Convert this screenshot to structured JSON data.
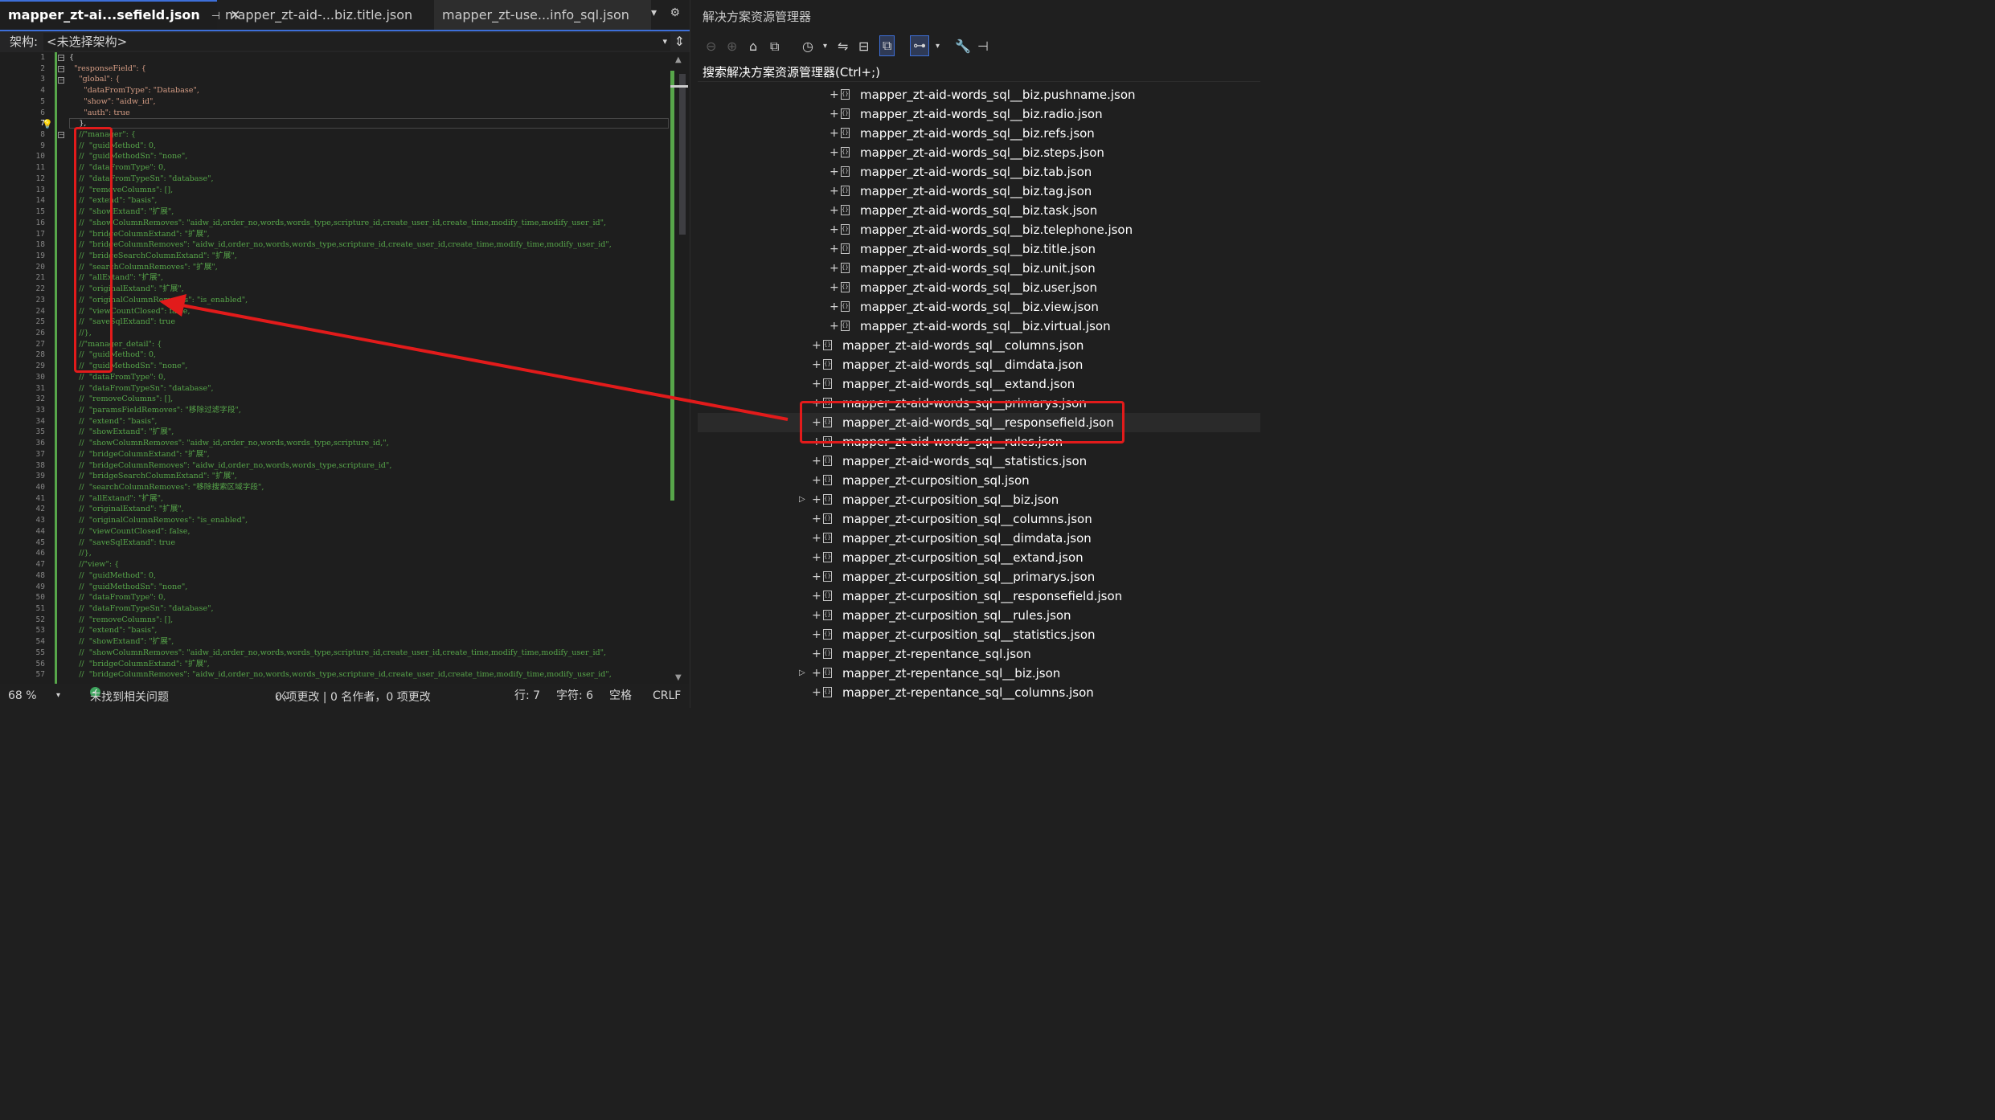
{
  "tabs": [
    {
      "label": "mapper_zt-ai...sefield.json",
      "active": true
    },
    {
      "label": "mapper_zt-aid-...biz.title.json",
      "active": false
    },
    {
      "label": "mapper_zt-use...info_sql.json",
      "active": false
    }
  ],
  "arch": {
    "label": "架构:",
    "value": "<未选择架构>"
  },
  "code_lines": [
    {
      "n": "1",
      "text": "{",
      "cls": ""
    },
    {
      "n": "2",
      "text": "  \"responseField\": {",
      "cls": ""
    },
    {
      "n": "3",
      "text": "    \"global\": {",
      "cls": ""
    },
    {
      "n": "4",
      "text": "      \"dataFromType\": \"Database\",",
      "cls": ""
    },
    {
      "n": "5",
      "text": "      \"show\": \"aidw_id\",",
      "cls": ""
    },
    {
      "n": "6",
      "text": "      \"auth\": true",
      "cls": ""
    },
    {
      "n": "7",
      "text": "    },",
      "cls": ""
    },
    {
      "n": "8",
      "text": "    //\"manager\": {",
      "cls": "cmt"
    },
    {
      "n": "9",
      "text": "    //  \"guidMethod\": 0,",
      "cls": "cmt"
    },
    {
      "n": "10",
      "text": "    //  \"guidMethodSn\": \"none\",",
      "cls": "cmt"
    },
    {
      "n": "11",
      "text": "    //  \"dataFromType\": 0,",
      "cls": "cmt"
    },
    {
      "n": "12",
      "text": "    //  \"dataFromTypeSn\": \"database\",",
      "cls": "cmt"
    },
    {
      "n": "13",
      "text": "    //  \"removeColumns\": [],",
      "cls": "cmt"
    },
    {
      "n": "14",
      "text": "    //  \"extend\": \"basis\",",
      "cls": "cmt"
    },
    {
      "n": "15",
      "text": "    //  \"showExtand\": \"扩展\",",
      "cls": "cmt"
    },
    {
      "n": "16",
      "text": "    //  \"showColumnRemoves\": \"aidw_id,order_no,words,words_type,scripture_id,create_user_id,create_time,modify_time,modify_user_id\",",
      "cls": "cmt"
    },
    {
      "n": "17",
      "text": "    //  \"bridgeColumnExtand\": \"扩展\",",
      "cls": "cmt"
    },
    {
      "n": "18",
      "text": "    //  \"bridgeColumnRemoves\": \"aidw_id,order_no,words,words_type,scripture_id,create_user_id,create_time,modify_time,modify_user_id\",",
      "cls": "cmt"
    },
    {
      "n": "19",
      "text": "    //  \"bridgeSearchColumnExtand\": \"扩展\",",
      "cls": "cmt"
    },
    {
      "n": "20",
      "text": "    //  \"searchColumnRemoves\": \"扩展\",",
      "cls": "cmt"
    },
    {
      "n": "21",
      "text": "    //  \"allExtand\": \"扩展\",",
      "cls": "cmt"
    },
    {
      "n": "22",
      "text": "    //  \"originalExtand\": \"扩展\",",
      "cls": "cmt"
    },
    {
      "n": "23",
      "text": "    //  \"originalColumnRemoves\": \"is_enabled\",",
      "cls": "cmt"
    },
    {
      "n": "24",
      "text": "    //  \"viewCountClosed\": false,",
      "cls": "cmt"
    },
    {
      "n": "25",
      "text": "    //  \"saveSqlExtand\": true",
      "cls": "cmt"
    },
    {
      "n": "26",
      "text": "    //},",
      "cls": "cmt"
    },
    {
      "n": "27",
      "text": "    //\"manager_detail\": {",
      "cls": "cmt"
    },
    {
      "n": "28",
      "text": "    //  \"guidMethod\": 0,",
      "cls": "cmt"
    },
    {
      "n": "29",
      "text": "    //  \"guidMethodSn\": \"none\",",
      "cls": "cmt"
    },
    {
      "n": "30",
      "text": "    //  \"dataFromType\": 0,",
      "cls": "cmt"
    },
    {
      "n": "31",
      "text": "    //  \"dataFromTypeSn\": \"database\",",
      "cls": "cmt"
    },
    {
      "n": "32",
      "text": "    //  \"removeColumns\": [],",
      "cls": "cmt"
    },
    {
      "n": "33",
      "text": "    //  \"paramsFieldRemoves\": \"移除过滤字段\",",
      "cls": "cmt"
    },
    {
      "n": "34",
      "text": "    //  \"extend\": \"basis\",",
      "cls": "cmt"
    },
    {
      "n": "35",
      "text": "    //  \"showExtand\": \"扩展\",",
      "cls": "cmt"
    },
    {
      "n": "36",
      "text": "    //  \"showColumnRemoves\": \"aidw_id,order_no,words,words_type,scripture_id,\",",
      "cls": "cmt"
    },
    {
      "n": "37",
      "text": "    //  \"bridgeColumnExtand\": \"扩展\",",
      "cls": "cmt"
    },
    {
      "n": "38",
      "text": "    //  \"bridgeColumnRemoves\": \"aidw_id,order_no,words,words_type,scripture_id\",",
      "cls": "cmt"
    },
    {
      "n": "39",
      "text": "    //  \"bridgeSearchColumnExtand\": \"扩展\",",
      "cls": "cmt"
    },
    {
      "n": "40",
      "text": "    //  \"searchColumnRemoves\": \"移除搜索区域字段\",",
      "cls": "cmt"
    },
    {
      "n": "41",
      "text": "    //  \"allExtand\": \"扩展\",",
      "cls": "cmt"
    },
    {
      "n": "42",
      "text": "    //  \"originalExtand\": \"扩展\",",
      "cls": "cmt"
    },
    {
      "n": "43",
      "text": "    //  \"originalColumnRemoves\": \"is_enabled\",",
      "cls": "cmt"
    },
    {
      "n": "44",
      "text": "    //  \"viewCountClosed\": false,",
      "cls": "cmt"
    },
    {
      "n": "45",
      "text": "    //  \"saveSqlExtand\": true",
      "cls": "cmt"
    },
    {
      "n": "46",
      "text": "    //},",
      "cls": "cmt"
    },
    {
      "n": "47",
      "text": "    //\"view\": {",
      "cls": "cmt"
    },
    {
      "n": "48",
      "text": "    //  \"guidMethod\": 0,",
      "cls": "cmt"
    },
    {
      "n": "49",
      "text": "    //  \"guidMethodSn\": \"none\",",
      "cls": "cmt"
    },
    {
      "n": "50",
      "text": "    //  \"dataFromType\": 0,",
      "cls": "cmt"
    },
    {
      "n": "51",
      "text": "    //  \"dataFromTypeSn\": \"database\",",
      "cls": "cmt"
    },
    {
      "n": "52",
      "text": "    //  \"removeColumns\": [],",
      "cls": "cmt"
    },
    {
      "n": "53",
      "text": "    //  \"extend\": \"basis\",",
      "cls": "cmt"
    },
    {
      "n": "54",
      "text": "    //  \"showExtand\": \"扩展\",",
      "cls": "cmt"
    },
    {
      "n": "55",
      "text": "    //  \"showColumnRemoves\": \"aidw_id,order_no,words,words_type,scripture_id,create_user_id,create_time,modify_time,modify_user_id\",",
      "cls": "cmt"
    },
    {
      "n": "56",
      "text": "    //  \"bridgeColumnExtand\": \"扩展\",",
      "cls": "cmt"
    },
    {
      "n": "57",
      "text": "    //  \"bridgeColumnRemoves\": \"aidw_id,order_no,words,words_type,scripture_id,create_user_id,create_time,modify_time,modify_user_id\",",
      "cls": "cmt"
    }
  ],
  "status": {
    "zoom": "68 %",
    "issues": "未找到相关问题",
    "changes": "0 项更改 | 0 名作者，0 项更改",
    "line": "行: 7",
    "char": "字符: 6",
    "indent": "空格",
    "eol": "CRLF"
  },
  "solution": {
    "title": "解决方案资源管理器",
    "search": "搜索解决方案资源管理器(Ctrl+;)",
    "items": [
      {
        "name": "mapper_zt-aid-words_sql__biz.pushname.json",
        "level": 2,
        "expand": false
      },
      {
        "name": "mapper_zt-aid-words_sql__biz.radio.json",
        "level": 2,
        "expand": false
      },
      {
        "name": "mapper_zt-aid-words_sql__biz.refs.json",
        "level": 2,
        "expand": false
      },
      {
        "name": "mapper_zt-aid-words_sql__biz.steps.json",
        "level": 2,
        "expand": false
      },
      {
        "name": "mapper_zt-aid-words_sql__biz.tab.json",
        "level": 2,
        "expand": false
      },
      {
        "name": "mapper_zt-aid-words_sql__biz.tag.json",
        "level": 2,
        "expand": false
      },
      {
        "name": "mapper_zt-aid-words_sql__biz.task.json",
        "level": 2,
        "expand": false
      },
      {
        "name": "mapper_zt-aid-words_sql__biz.telephone.json",
        "level": 2,
        "expand": false
      },
      {
        "name": "mapper_zt-aid-words_sql__biz.title.json",
        "level": 2,
        "expand": false
      },
      {
        "name": "mapper_zt-aid-words_sql__biz.unit.json",
        "level": 2,
        "expand": false
      },
      {
        "name": "mapper_zt-aid-words_sql__biz.user.json",
        "level": 2,
        "expand": false
      },
      {
        "name": "mapper_zt-aid-words_sql__biz.view.json",
        "level": 2,
        "expand": false
      },
      {
        "name": "mapper_zt-aid-words_sql__biz.virtual.json",
        "level": 2,
        "expand": false
      },
      {
        "name": "mapper_zt-aid-words_sql__columns.json",
        "level": 1,
        "expand": false
      },
      {
        "name": "mapper_zt-aid-words_sql__dimdata.json",
        "level": 1,
        "expand": false
      },
      {
        "name": "mapper_zt-aid-words_sql__extand.json",
        "level": 1,
        "expand": false
      },
      {
        "name": "mapper_zt-aid-words_sql__primarys.json",
        "level": 1,
        "expand": false
      },
      {
        "name": "mapper_zt-aid-words_sql__responsefield.json",
        "level": 1,
        "expand": false,
        "selected": true
      },
      {
        "name": "mapper_zt-aid-words_sql__rules.json",
        "level": 1,
        "expand": false
      },
      {
        "name": "mapper_zt-aid-words_sql__statistics.json",
        "level": 1,
        "expand": false
      },
      {
        "name": "mapper_zt-curposition_sql.json",
        "level": 1,
        "expand": false
      },
      {
        "name": "mapper_zt-curposition_sql__biz.json",
        "level": 1,
        "expand": true
      },
      {
        "name": "mapper_zt-curposition_sql__columns.json",
        "level": 1,
        "expand": false
      },
      {
        "name": "mapper_zt-curposition_sql__dimdata.json",
        "level": 1,
        "expand": false
      },
      {
        "name": "mapper_zt-curposition_sql__extand.json",
        "level": 1,
        "expand": false
      },
      {
        "name": "mapper_zt-curposition_sql__primarys.json",
        "level": 1,
        "expand": false
      },
      {
        "name": "mapper_zt-curposition_sql__responsefield.json",
        "level": 1,
        "expand": false
      },
      {
        "name": "mapper_zt-curposition_sql__rules.json",
        "level": 1,
        "expand": false
      },
      {
        "name": "mapper_zt-curposition_sql__statistics.json",
        "level": 1,
        "expand": false
      },
      {
        "name": "mapper_zt-repentance_sql.json",
        "level": 1,
        "expand": false
      },
      {
        "name": "mapper_zt-repentance_sql__biz.json",
        "level": 1,
        "expand": true
      },
      {
        "name": "mapper_zt-repentance_sql__columns.json",
        "level": 1,
        "expand": false
      }
    ]
  },
  "colors": {
    "accent": "#3d6fd9",
    "highlight_red": "#e21b1b",
    "comment_green": "#57a64a",
    "string": "#d69d85",
    "keyword": "#569cd6"
  }
}
